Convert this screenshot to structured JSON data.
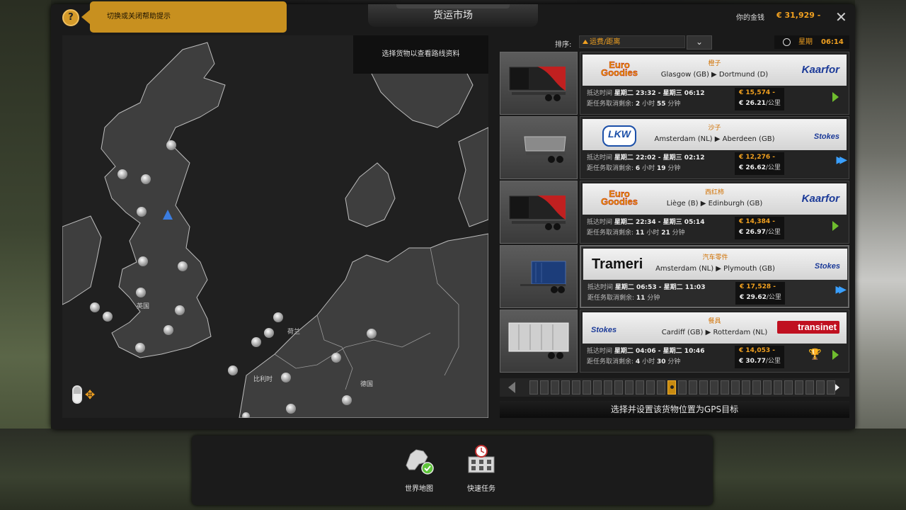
{
  "window_title": "货运市场",
  "help": {
    "button_label": "?",
    "tooltip": "切换或关闭帮助提示"
  },
  "money": {
    "label": "你的金钱",
    "value": "€ 31,929 -"
  },
  "close_label": "✕",
  "map": {
    "hint": "选择货物以查看路线资料",
    "labels": {
      "uk": "英国",
      "nl": "荷兰",
      "be": "比利时",
      "de": "德国"
    }
  },
  "sort": {
    "label": "排序:",
    "selected": "运费/距离",
    "dropdown_icon": "chevron-down-icon"
  },
  "clock": {
    "day": "星期",
    "time": "06:14"
  },
  "jobs": [
    {
      "cargo": "橙子",
      "route": "Glasgow (GB) ▶ Dortmund (D)",
      "source_company": "Euro Goodies",
      "dest_company": "Kaarfor",
      "deliver_label": "抵达时间",
      "deliver_time": "星期二 23:32 - 星期三 06:12",
      "cancel_label": "距任务取消剩余:",
      "cancel_h": "2",
      "cancel_m": "55",
      "price": "€ 15,574 -",
      "per_km": "€ 26.21",
      "per_km_unit": "/公里",
      "action": "arrow",
      "trailer": "reefer"
    },
    {
      "cargo": "沙子",
      "route": "Amsterdam (NL) ▶ Aberdeen (GB)",
      "source_company": "LKW",
      "dest_company": "Stokes",
      "deliver_label": "抵达时间",
      "deliver_time": "星期二 22:02 - 星期三 02:12",
      "cancel_label": "距任务取消剩余:",
      "cancel_h": "6",
      "cancel_m": "19",
      "price": "€ 12,276 -",
      "per_km": "€ 26.62",
      "per_km_unit": "/公里",
      "action": "fast",
      "trailer": "tipper"
    },
    {
      "cargo": "西红柿",
      "route": "Liège (B) ▶ Edinburgh (GB)",
      "source_company": "Euro Goodies",
      "dest_company": "Kaarfor",
      "deliver_label": "抵达时间",
      "deliver_time": "星期二 22:34 - 星期三 05:14",
      "cancel_label": "距任务取消剩余:",
      "cancel_h": "11",
      "cancel_m": "21",
      "price": "€ 14,384 -",
      "per_km": "€ 26.97",
      "per_km_unit": "/公里",
      "action": "arrow",
      "trailer": "reefer"
    },
    {
      "cargo": "汽车零件",
      "route": "Amsterdam (NL) ▶ Plymouth (GB)",
      "source_company": "Trameri",
      "dest_company": "Stokes",
      "deliver_label": "抵达时间",
      "deliver_time": "星期二 06:53 - 星期二 11:03",
      "cancel_label": "距任务取消剩余:",
      "cancel_h": "",
      "cancel_m": "11",
      "price": "€ 17,528 -",
      "per_km": "€ 29.62",
      "per_km_unit": "/公里",
      "action": "fast",
      "trailer": "container"
    },
    {
      "cargo": "餐具",
      "route": "Cardiff (GB) ▶ Rotterdam (NL)",
      "source_company": "Stokes",
      "dest_company": "transinet",
      "deliver_label": "抵达时间",
      "deliver_time": "星期二 04:06 - 星期二 10:46",
      "cancel_label": "距任务取消剩余:",
      "cancel_h": "4",
      "cancel_m": "30",
      "price": "€ 14,053 -",
      "per_km": "€ 30.77",
      "per_km_unit": "/公里",
      "action": "trophy",
      "trailer": "curtain"
    }
  ],
  "units": {
    "hours": "小时",
    "minutes": "分钟"
  },
  "pager": {
    "total_pages": 29,
    "active_page": 13
  },
  "gps_button": "选择并设置该货物位置为GPS目标",
  "dock": [
    {
      "label": "世界地图",
      "icon": "world-map-icon"
    },
    {
      "label": "快速任务",
      "icon": "quick-job-icon"
    }
  ]
}
